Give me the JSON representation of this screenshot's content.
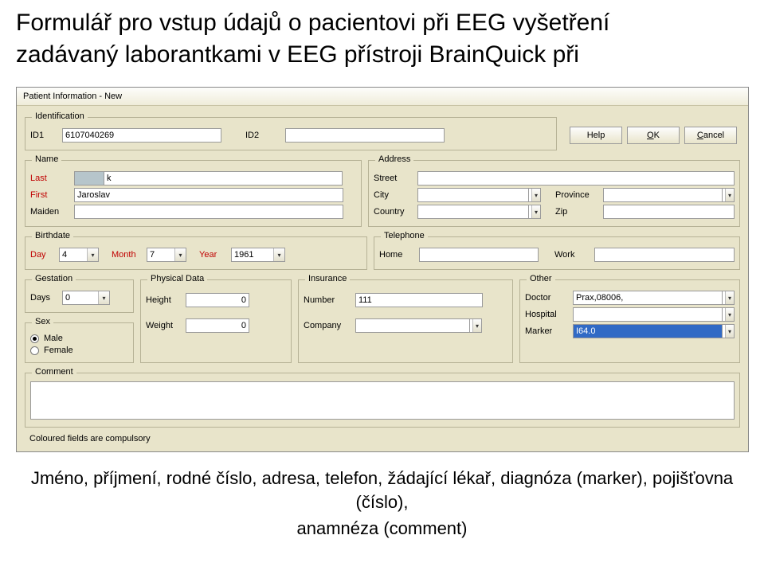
{
  "page": {
    "title_line1": "Formulář pro vstup údajů o pacientovi při EEG vyšetření",
    "title_line2": "zadávaný laborantkami v EEG přístroji BrainQuick při",
    "footer_line1": "Jméno, příjmení, rodné číslo, adresa, telefon, žádající lékař, diagnóza (marker), pojišťovna (číslo),",
    "footer_line2": "anamnéza (comment)"
  },
  "window": {
    "title": "Patient Information - New"
  },
  "identification": {
    "legend": "Identification",
    "id1_label": "ID1",
    "id1_value": "6107040269",
    "id2_label": "ID2",
    "id2_value": ""
  },
  "buttons": {
    "help": "Help",
    "ok_prefix": "O",
    "ok_rest": "K",
    "cancel_prefix": "C",
    "cancel_rest": "ancel"
  },
  "name": {
    "legend": "Name",
    "last_label": "Last",
    "last_value": "k",
    "first_label": "First",
    "first_value": "Jaroslav",
    "maiden_label": "Maiden",
    "maiden_value": ""
  },
  "address": {
    "legend": "Address",
    "street_label": "Street",
    "street_value": "",
    "city_label": "City",
    "city_value": "",
    "province_label": "Province",
    "province_value": "",
    "country_label": "Country",
    "country_value": "",
    "zip_label": "Zip",
    "zip_value": ""
  },
  "birthdate": {
    "legend": "Birthdate",
    "day_label": "Day",
    "day_value": "4",
    "month_label": "Month",
    "month_value": "7",
    "year_label": "Year",
    "year_value": "1961"
  },
  "telephone": {
    "legend": "Telephone",
    "home_label": "Home",
    "home_value": "",
    "work_label": "Work",
    "work_value": ""
  },
  "gestation": {
    "legend": "Gestation",
    "days_label": "Days",
    "days_value": "0"
  },
  "physical": {
    "legend": "Physical Data",
    "height_label": "Height",
    "height_value": "0",
    "weight_label": "Weight",
    "weight_value": "0"
  },
  "insurance": {
    "legend": "Insurance",
    "number_label": "Number",
    "number_value": "111",
    "company_label": "Company",
    "company_value": ""
  },
  "other": {
    "legend": "Other",
    "doctor_label": "Doctor",
    "doctor_value": "Prax,08006,",
    "hospital_label": "Hospital",
    "hospital_value": "",
    "marker_label": "Marker",
    "marker_value": "I64.0"
  },
  "sex": {
    "legend": "Sex",
    "male_label": "Male",
    "female_label": "Female",
    "selected": "male"
  },
  "comment": {
    "legend": "Comment",
    "value": ""
  },
  "hint": "Coloured fields are compulsory"
}
